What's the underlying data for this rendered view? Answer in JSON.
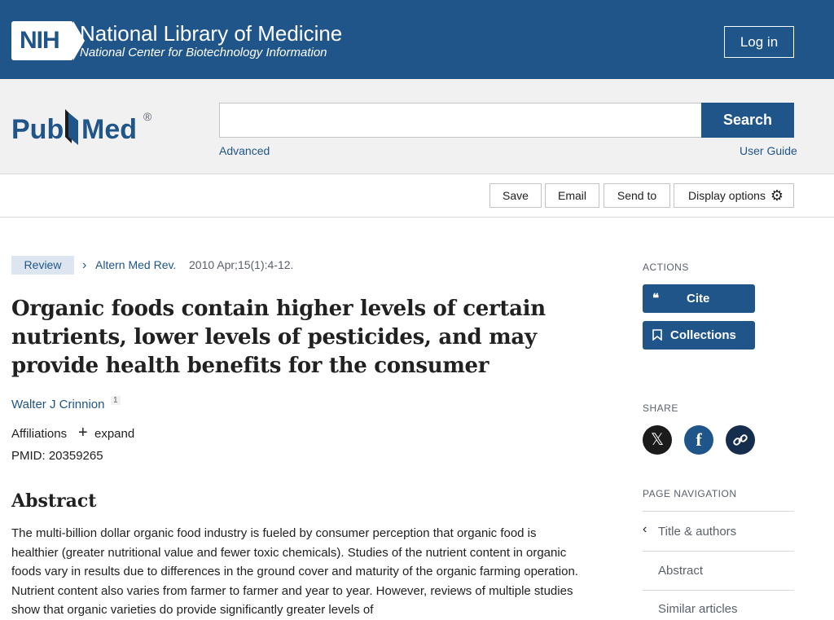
{
  "nih": {
    "logo_text": "NIH",
    "title": "National Library of Medicine",
    "subtitle": "National Center for Biotechnology Information",
    "login_label": "Log in"
  },
  "search": {
    "logo_text": "PubMed",
    "input_value": "",
    "placeholder": "",
    "button_label": "Search",
    "advanced_label": "Advanced",
    "guide_label": "User Guide"
  },
  "toolbar": {
    "save": "Save",
    "email": "Email",
    "send_to": "Send to",
    "display": "Display options"
  },
  "article": {
    "type_badge": "Review",
    "journal": "Altern Med Rev.",
    "citation": "2010 Apr;15(1):4-12.",
    "title": "Organic foods contain higher levels of certain nutrients, lower levels of pesticides, and may provide health benefits for the consumer",
    "author": "Walter J Crinnion",
    "author_sup": "1",
    "affiliations_label": "Affiliations",
    "expand_label": "expand",
    "pmid": "PMID: 20359265",
    "abstract_heading": "Abstract",
    "abstract_text": "The multi-billion dollar organic food industry is fueled by consumer perception that organic food is healthier (greater nutritional value and fewer toxic chemicals). Studies of the nutrient content in organic foods vary in results due to differences in the ground cover and maturity of the organic farming operation. Nutrient content also varies from farmer to farmer and year to year. However, reviews of multiple studies show that organic varieties do provide significantly greater levels of"
  },
  "sidebar": {
    "actions_label": "ACTIONS",
    "cite_label": "Cite",
    "collections_label": "Collections",
    "share_label": "SHARE",
    "page_nav_label": "PAGE NAVIGATION",
    "nav_items": [
      "Title & authors",
      "Abstract",
      "Similar articles"
    ]
  },
  "colors": {
    "brand_blue": "#20558a",
    "facebook_blue": "#20558a",
    "x_black": "#1b1b1b"
  }
}
